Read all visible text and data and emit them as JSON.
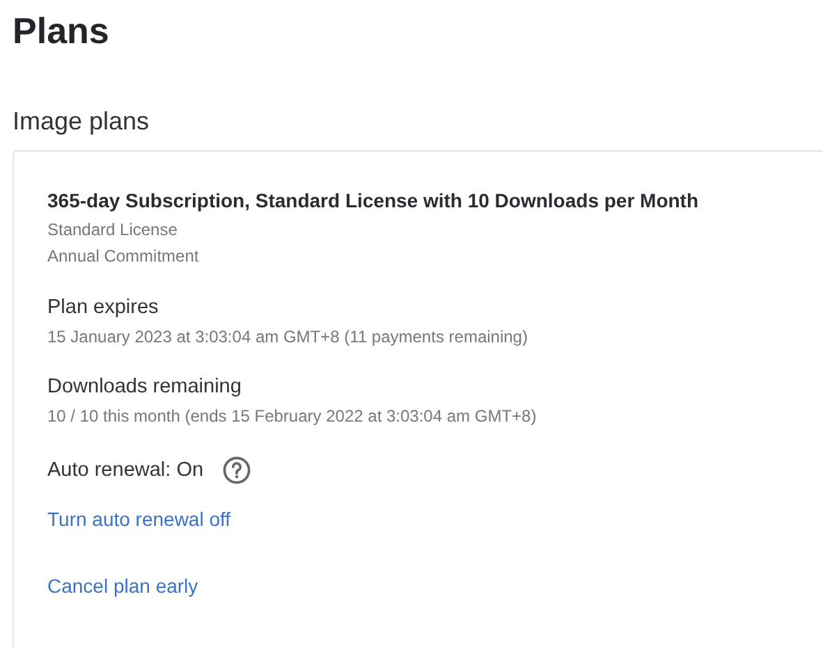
{
  "page_title": "Plans",
  "section_title": "Image plans",
  "plan": {
    "name": "365-day Subscription, Standard License with 10 Downloads per Month",
    "details": [
      "Standard License",
      "Annual Commitment"
    ],
    "fields": [
      {
        "label": "Plan expires",
        "value": "15 January 2023 at 3:03:04 am GMT+8 (11 payments remaining)"
      },
      {
        "label": "Downloads remaining",
        "value": "10 / 10 this month (ends 15 February 2022 at 3:03:04 am GMT+8)"
      }
    ],
    "auto_renewal": "Auto renewal: On",
    "links": [
      "Turn auto renewal off",
      "Cancel plan early"
    ]
  }
}
